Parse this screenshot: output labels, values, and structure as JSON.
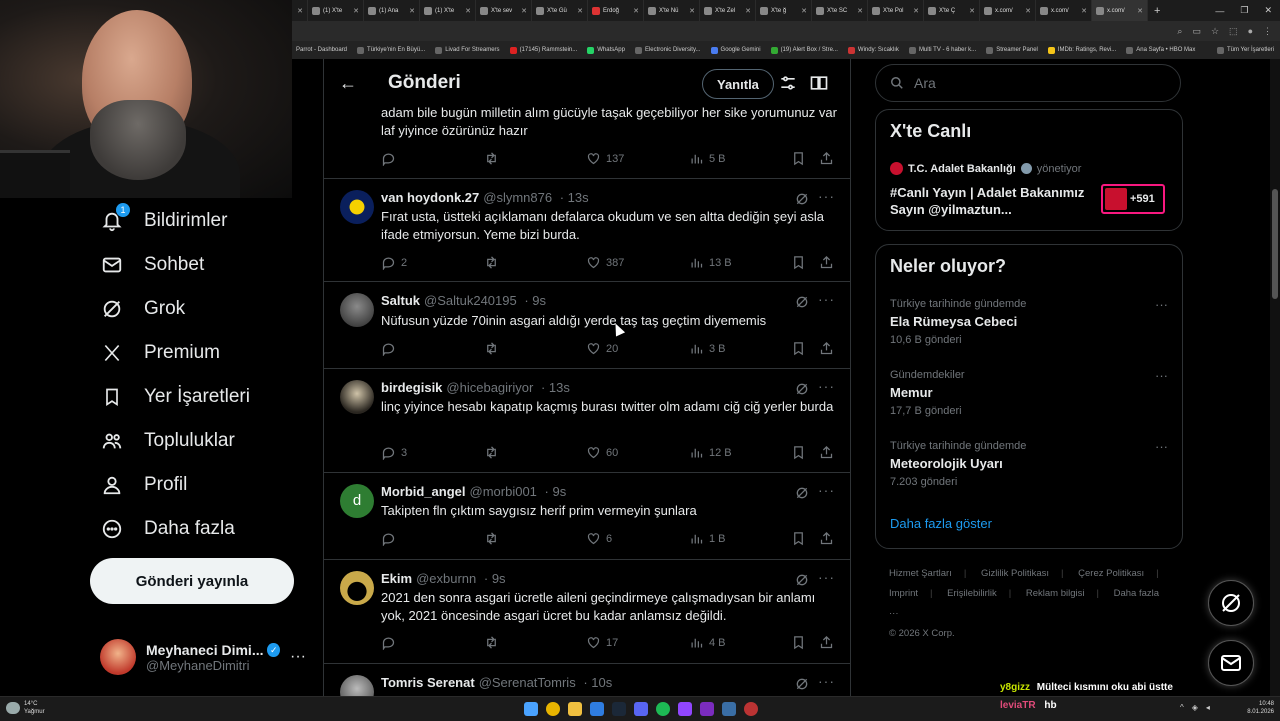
{
  "browser": {
    "tabs": [
      "(1) X'te",
      "(1) Ana",
      "(1) X'te",
      "X'te sev",
      "X'te Gü",
      "Erdoğ",
      "X'te Nü",
      "X'te Zel",
      "X'te ğ",
      "X'te SC",
      "X'te Pol",
      "X'te Ç",
      "x.com/",
      "x.com/",
      "x.com/"
    ],
    "bookmarks": [
      "Parrot - Dashboard",
      "Türkiye'nin En Büyü...",
      "Livad For Streamers",
      "(17145) Rammstein...",
      "WhatsApp",
      "Electronic Diversity...",
      "Google Gemini",
      "(19) Alert Box / Stre...",
      "Windy: Sıcaklık",
      "Multi TV - 6 haber k...",
      "Streamer Panel",
      "IMDb: Ratings, Revi...",
      "Ana Sayfa • HBO Max",
      "Tüm Yer İşaretleri"
    ]
  },
  "nav": {
    "items": [
      {
        "label": "Bildirimler",
        "icon": "bell-icon",
        "badge": "1"
      },
      {
        "label": "Sohbet",
        "icon": "mail-icon"
      },
      {
        "label": "Grok",
        "icon": "grok-icon"
      },
      {
        "label": "Premium",
        "icon": "x-logo-icon"
      },
      {
        "label": "Yer İşaretleri",
        "icon": "bookmark-icon"
      },
      {
        "label": "Topluluklar",
        "icon": "people-icon"
      },
      {
        "label": "Profil",
        "icon": "person-icon"
      },
      {
        "label": "Daha fazla",
        "icon": "more-circle-icon"
      }
    ],
    "post_button": "Gönderi yayınla",
    "account": {
      "name": "Meyhaneci Dimi...",
      "handle": "@MeyhaneDimitri"
    }
  },
  "center": {
    "title": "Gönderi",
    "reply_button": "Yanıtla",
    "tweets": [
      {
        "name": "",
        "handle": "",
        "time": "",
        "text": "adam bile bugün milletin alım gücüyle taşak geçebiliyor her sike yorumunuz var laf yiyince özürünüz hazır",
        "replies": "",
        "retweets": "",
        "likes": "137",
        "views": "5 B"
      },
      {
        "name": "van hoydonk.27",
        "handle": "@slymn876",
        "time": "· 13s",
        "text": "Fırat usta, üstteki açıklamanı defalarca okudum ve sen altta dediğin şeyi asla ifade etmiyorsun. Yeme bizi burda.",
        "replies": "2",
        "retweets": "",
        "likes": "387",
        "views": "13 B"
      },
      {
        "name": "Saltuk",
        "handle": "@Saltuk240195",
        "time": "· 9s",
        "text": "Nüfusun yüzde 70inin asgari aldığı yerde taş taş geçtim diyememis",
        "replies": "",
        "retweets": "",
        "likes": "20",
        "views": "3 B"
      },
      {
        "name": "birdegisik",
        "handle": "@hicebagiriyor",
        "time": "· 13s",
        "text": "linç yiyince hesabı kapatıp kaçmış burası twitter olm adamı ciğ ciğ yerler burda",
        "replies": "3",
        "retweets": "",
        "likes": "60",
        "views": "12 B"
      },
      {
        "name": "Morbid_angel",
        "handle": "@morbi001",
        "time": "· 9s",
        "text": "Takipten fln çıktım saygısız herif prim vermeyin şunlara",
        "replies": "",
        "retweets": "",
        "likes": "6",
        "views": "1 B",
        "avatar_letter": "d"
      },
      {
        "name": "Ekim",
        "handle": "@exburnn",
        "time": "· 9s",
        "text": "2021 den sonra asgari ücretle aileni geçindirmeye çalışmadıysan bir anlamı yok, 2021 öncesinde asgari ücret bu kadar anlamsız değildi.",
        "replies": "",
        "retweets": "",
        "likes": "17",
        "views": "4 B"
      },
      {
        "name": "Tomris Serenat",
        "handle": "@SerenatTomris",
        "time": "· 10s",
        "text": "",
        "replies": "",
        "retweets": "",
        "likes": "",
        "views": ""
      }
    ]
  },
  "right": {
    "search_placeholder": "Ara",
    "live": {
      "title": "X'te Canlı",
      "host": "T.C. Adalet Bakanlığı",
      "host_role": "yönetiyor",
      "text": "#Canlı Yayın | Adalet Bakanımız Sayın @yilmaztun...",
      "count": "+591"
    },
    "trends": {
      "title": "Neler oluyor?",
      "items": [
        {
          "context": "Türkiye tarihinde gündemde",
          "name": "Ela Rümeysa Cebeci",
          "count": "10,6 B gönderi"
        },
        {
          "context": "Gündemdekiler",
          "name": "Memur",
          "count": "17,7 B gönderi"
        },
        {
          "context": "Türkiye tarihinde gündemde",
          "name": "Meteorolojik Uyarı",
          "count": "7.203 gönderi"
        }
      ],
      "show_more": "Daha fazla göster"
    },
    "footer": [
      "Hizmet Şartları",
      "Gizlilik Politikası",
      "Çerez Politikası",
      "Imprint",
      "Erişilebilirlik",
      "Reklam bilgisi",
      "Daha fazla ···",
      "© 2026 X Corp."
    ]
  },
  "overlay": {
    "chat": [
      {
        "user": "y8gizz",
        "message": "Mülteci kısmını oku abi üstte",
        "color": "#c8e600"
      },
      {
        "user": "leviaTR",
        "message": "hb",
        "color": "#e04b7a"
      }
    ]
  },
  "taskbar": {
    "weather_temp": "14°C",
    "weather_desc": "Yağmur",
    "time": "10:48",
    "date": "8.01.2026"
  },
  "colors": {
    "accent": "#1d9bf0",
    "muted": "#71767b",
    "border": "#2f3336",
    "live_pink": "#f91880"
  }
}
